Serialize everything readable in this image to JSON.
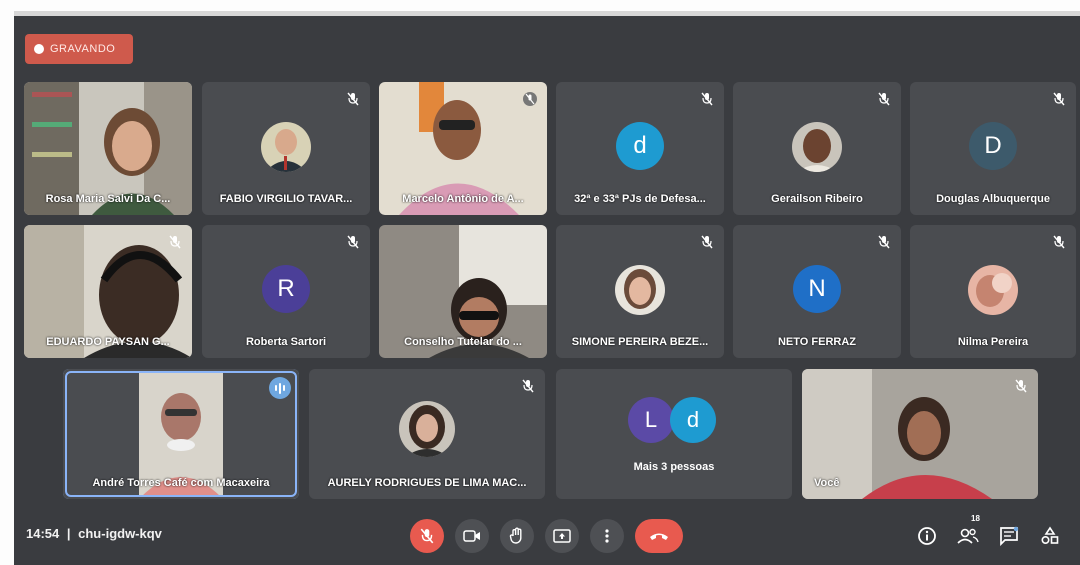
{
  "recording": {
    "label": "GRAVANDO"
  },
  "row1": [
    {
      "name": "Rosa Maria Salvi Da C...",
      "type": "video"
    },
    {
      "name": "FABIO VIRGILIO TAVAR...",
      "type": "photo"
    },
    {
      "name": "Marcelo Antônio de A...",
      "type": "video"
    },
    {
      "name": "32ª e 33ª PJs de Defesa...",
      "type": "letter",
      "letter": "d",
      "color": "#1e9bd1"
    },
    {
      "name": "Gerailson Ribeiro",
      "type": "photo"
    },
    {
      "name": "Douglas Albuquerque",
      "type": "letter",
      "letter": "D",
      "color": "#3d5a6b"
    }
  ],
  "row2": [
    {
      "name": "EDUARDO PAYSAN G...",
      "type": "video"
    },
    {
      "name": "Roberta Sartori",
      "type": "letter",
      "letter": "R",
      "color": "#4b3f98"
    },
    {
      "name": "Conselho Tutelar do ...",
      "type": "video"
    },
    {
      "name": "SIMONE PEREIRA BEZE...",
      "type": "photo"
    },
    {
      "name": "NETO FERRAZ",
      "type": "letter",
      "letter": "N",
      "color": "#1f6fc7"
    },
    {
      "name": "Nilma Pereira",
      "type": "photo"
    }
  ],
  "row3": [
    {
      "name": "André Torres Café com Macaxeira",
      "type": "video"
    },
    {
      "name": "AURELY RODRIGUES DE LIMA MAC...",
      "type": "photo"
    },
    {
      "name": "Mais 3 pessoas",
      "type": "more",
      "letters": [
        "L",
        "d"
      ],
      "colors": [
        "#5b4aa6",
        "#1e9bd1"
      ]
    },
    {
      "name": "Você",
      "type": "video"
    }
  ],
  "footer": {
    "time": "14:54",
    "separator": "|",
    "meeting_code": "chu-igdw-kqv",
    "participants_count": "18"
  },
  "colors": {
    "end_call": "#e85a4f",
    "mic_off": "#e85a4f",
    "speaking": "#6fa7e0",
    "recording": "#cf5a4c"
  }
}
